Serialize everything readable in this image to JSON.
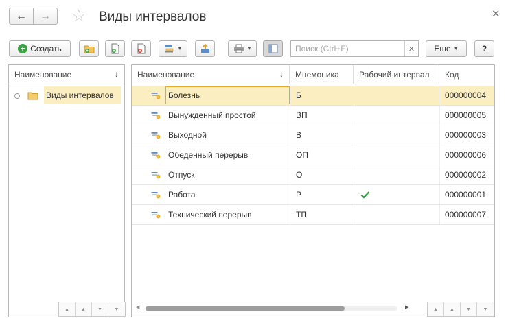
{
  "window": {
    "title": "Виды интервалов",
    "close_icon": "close-icon",
    "favorite_icon": "star-icon"
  },
  "toolbar": {
    "create_label": "Создать",
    "search_placeholder": "Поиск (Ctrl+F)",
    "more_label": "Еще",
    "help_label": "?"
  },
  "left_panel": {
    "column_header": "Наименование",
    "items": [
      {
        "label": "Виды интервалов",
        "selected": true
      }
    ]
  },
  "table": {
    "columns": [
      "Наименование",
      "Мнемоника",
      "Рабочий интервал",
      "Код"
    ],
    "rows": [
      {
        "name": "Болезнь",
        "mnemonic": "Б",
        "working": false,
        "code": "000000004",
        "selected": true
      },
      {
        "name": "Вынужденный простой",
        "mnemonic": "ВП",
        "working": false,
        "code": "000000005"
      },
      {
        "name": "Выходной",
        "mnemonic": "В",
        "working": false,
        "code": "000000003"
      },
      {
        "name": "Обеденный перерыв",
        "mnemonic": "ОП",
        "working": false,
        "code": "000000006"
      },
      {
        "name": "Отпуск",
        "mnemonic": "О",
        "working": false,
        "code": "000000002"
      },
      {
        "name": "Работа",
        "mnemonic": "Р",
        "working": true,
        "code": "000000001"
      },
      {
        "name": "Технический перерыв",
        "mnemonic": "ТП",
        "working": false,
        "code": "000000007"
      }
    ]
  },
  "colors": {
    "selection": "#fbeec0",
    "selected_cell_border": "#e8a92a",
    "check": "#2f9a3c",
    "create_icon": "#3aa345"
  }
}
